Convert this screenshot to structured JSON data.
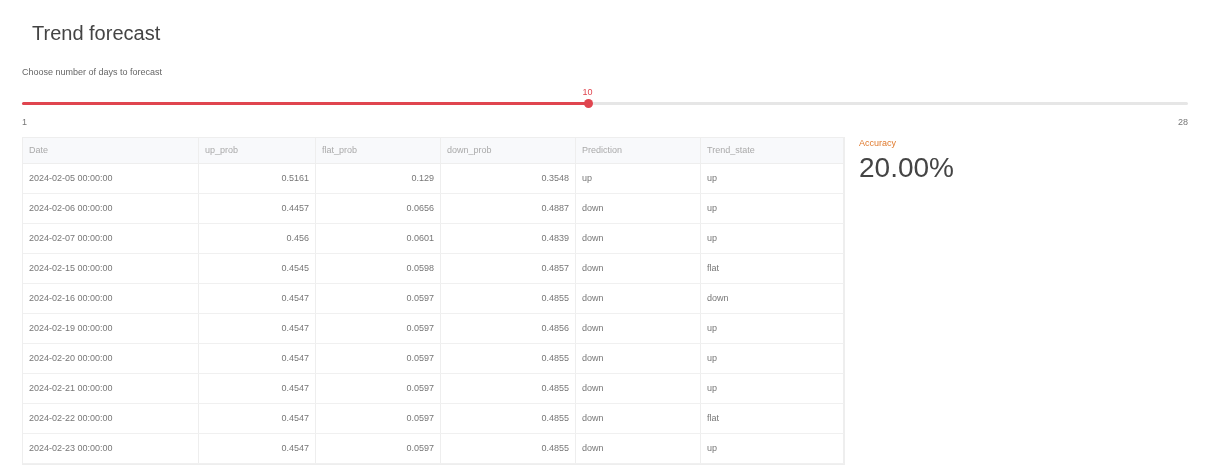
{
  "title": "Trend forecast",
  "slider": {
    "label": "Choose number of days to forecast",
    "value": "10",
    "min": "1",
    "max": "28",
    "level": 0.485
  },
  "table": {
    "columns": [
      "Date",
      "up_prob",
      "flat_prob",
      "down_prob",
      "Prediction",
      "Trend_state"
    ],
    "rows": [
      [
        "2024-02-05 00:00:00",
        "0.5161",
        "0.129",
        "0.3548",
        "up",
        "up"
      ],
      [
        "2024-02-06 00:00:00",
        "0.4457",
        "0.0656",
        "0.4887",
        "down",
        "up"
      ],
      [
        "2024-02-07 00:00:00",
        "0.456",
        "0.0601",
        "0.4839",
        "down",
        "up"
      ],
      [
        "2024-02-15 00:00:00",
        "0.4545",
        "0.0598",
        "0.4857",
        "down",
        "flat"
      ],
      [
        "2024-02-16 00:00:00",
        "0.4547",
        "0.0597",
        "0.4855",
        "down",
        "down"
      ],
      [
        "2024-02-19 00:00:00",
        "0.4547",
        "0.0597",
        "0.4856",
        "down",
        "up"
      ],
      [
        "2024-02-20 00:00:00",
        "0.4547",
        "0.0597",
        "0.4855",
        "down",
        "up"
      ],
      [
        "2024-02-21 00:00:00",
        "0.4547",
        "0.0597",
        "0.4855",
        "down",
        "up"
      ],
      [
        "2024-02-22 00:00:00",
        "0.4547",
        "0.0597",
        "0.4855",
        "down",
        "flat"
      ],
      [
        "2024-02-23 00:00:00",
        "0.4547",
        "0.0597",
        "0.4855",
        "down",
        "up"
      ]
    ]
  },
  "metric": {
    "label": "Accuracy",
    "value": "20.00%"
  }
}
